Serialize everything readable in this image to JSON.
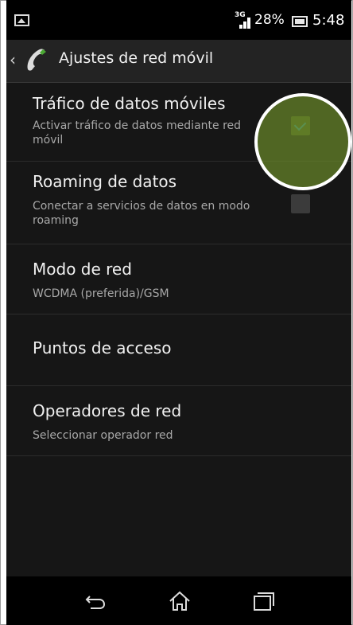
{
  "status_bar": {
    "network_type": "3G",
    "battery_percent": "28%",
    "time": "5:48"
  },
  "action_bar": {
    "title": "Ajustes de red móvil"
  },
  "settings": [
    {
      "title": "Tráfico de datos móviles",
      "summary": "Activar tráfico de datos mediante red móvil",
      "has_checkbox": true,
      "checked": true
    },
    {
      "title": "Roaming de datos",
      "summary": "Conectar a servicios de datos en modo roaming",
      "has_checkbox": true,
      "checked": false
    },
    {
      "title": "Modo de red",
      "summary": "WCDMA (preferida)/GSM",
      "has_checkbox": false
    },
    {
      "title": "Puntos de acceso",
      "summary": "",
      "has_checkbox": false
    },
    {
      "title": "Operadores de red",
      "summary": "Seleccionar operador red",
      "has_checkbox": false
    }
  ],
  "nav_bar": {
    "icons": [
      "back-icon",
      "home-icon",
      "recent-apps-icon"
    ]
  },
  "colors": {
    "touch_highlight": "#6a8a2a",
    "checkbox_check": "#3fb8c9"
  }
}
